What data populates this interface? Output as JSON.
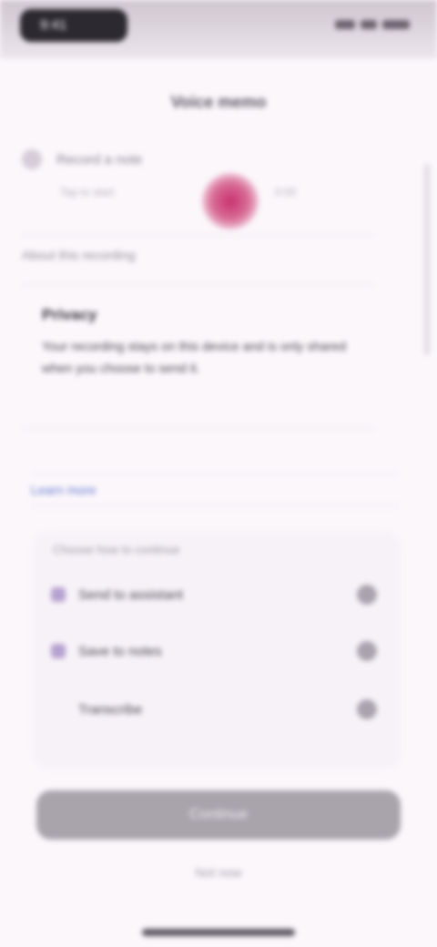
{
  "status_bar": {
    "time": "9:41"
  },
  "header": {
    "title": "Voice memo"
  },
  "recorder": {
    "section_label": "Record a note",
    "left_caption": "Tap to start",
    "record_caption": "0:00"
  },
  "section": {
    "heading": "About this recording"
  },
  "card": {
    "title": "Privacy",
    "body": "Your recording stays on this device and is only shared when you choose to send it."
  },
  "link": {
    "label": "Learn more"
  },
  "list": {
    "title": "Choose how to continue",
    "items": [
      {
        "label": "Send to assistant"
      },
      {
        "label": "Save to notes"
      },
      {
        "label": "Transcribe"
      }
    ]
  },
  "primary_button": {
    "label": "Continue"
  },
  "secondary_link": {
    "label": "Not now"
  }
}
